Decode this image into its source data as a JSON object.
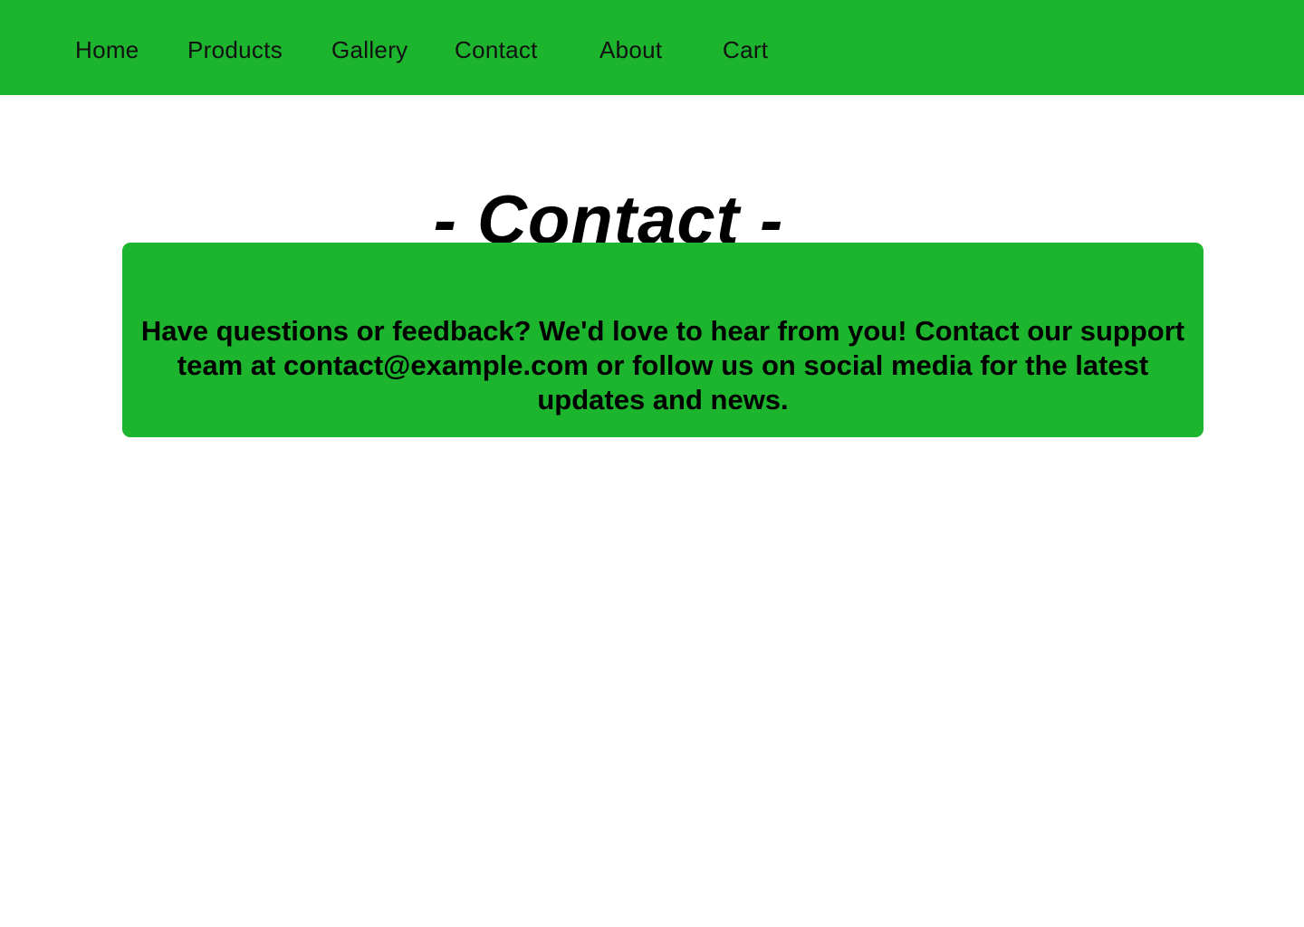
{
  "nav": {
    "items": [
      "Home",
      "Products",
      "Gallery",
      "Contact",
      "About",
      "Cart"
    ]
  },
  "page": {
    "title": "- Contact -"
  },
  "contact": {
    "message": "Have questions or feedback? We'd love to hear from you! Contact our support team at contact@example.com or follow us on social media for the latest updates and news."
  },
  "colors": {
    "accent": "#1db42e",
    "text": "#000000",
    "background": "#ffffff"
  }
}
